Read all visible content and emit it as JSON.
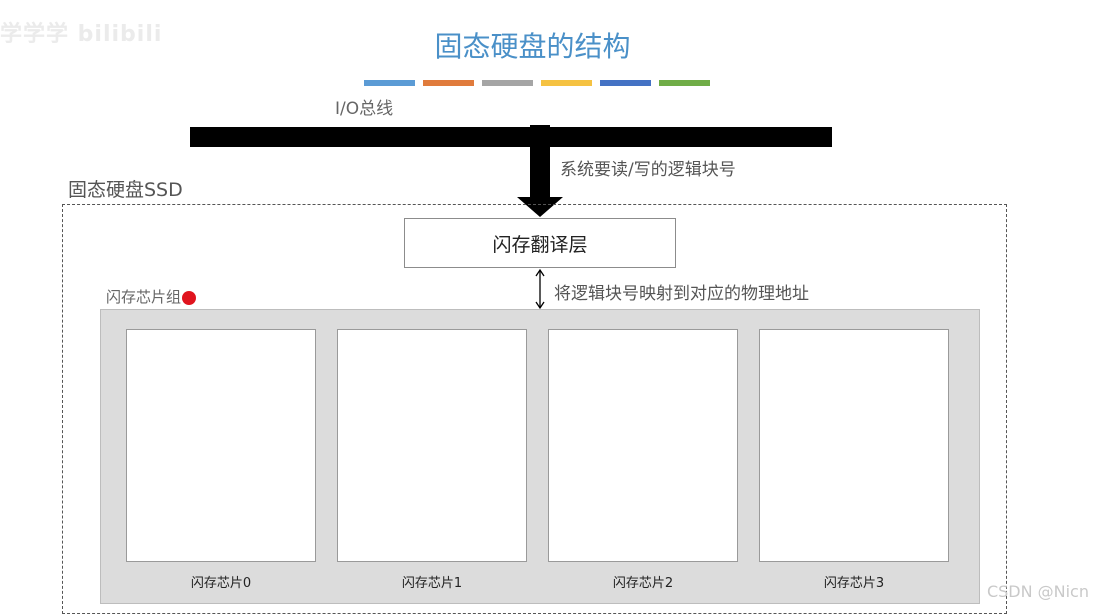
{
  "watermark": {
    "left": "学学学 bilibili",
    "right": "CSDN @Nicn"
  },
  "title": "固态硬盘的结构",
  "color_bars": [
    "#5b9bd5",
    "#e07b3c",
    "#a5a5a5",
    "#f5c242",
    "#4472c4",
    "#70ad47"
  ],
  "io_bus": {
    "label": "I/O总线"
  },
  "arrow_label": "系统要读/写的逻辑块号",
  "ssd": {
    "label": "固态硬盘SSD",
    "ftl_label": "闪存翻译层",
    "mapping_label": "将逻辑块号映射到对应的物理地址",
    "group_label": "闪存芯片组",
    "chips": [
      {
        "label": "闪存芯片0"
      },
      {
        "label": "闪存芯片1"
      },
      {
        "label": "闪存芯片2"
      },
      {
        "label": "闪存芯片3"
      }
    ]
  }
}
